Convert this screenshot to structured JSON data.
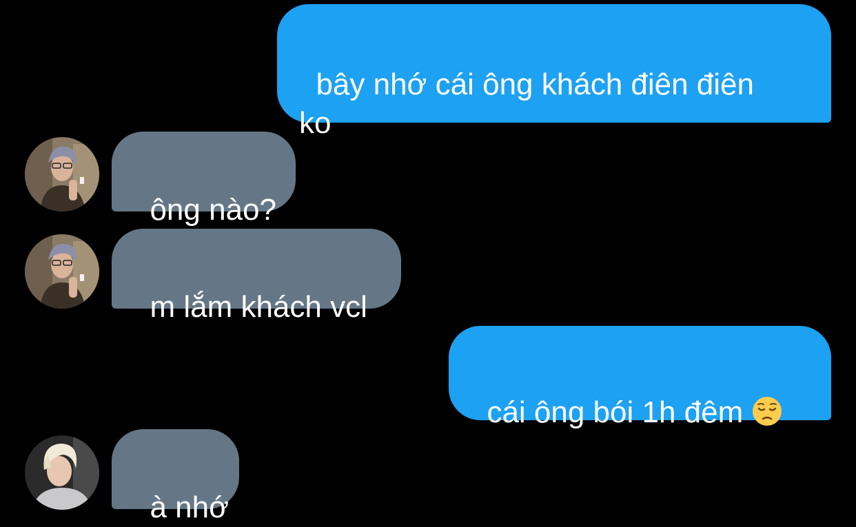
{
  "conversation": {
    "messages": [
      {
        "sender": "me",
        "text": "bây nhớ cái ông khách điên điên\nko"
      },
      {
        "sender": "them",
        "avatar": "avatar-gray-hair",
        "text": "ông nào?"
      },
      {
        "sender": "them",
        "avatar": "avatar-gray-hair",
        "text": "m lắm khách vcl"
      },
      {
        "sender": "me",
        "text": "cái ông bói 1h đêm ",
        "emoji": "pensive-face-emoji"
      },
      {
        "sender": "them",
        "avatar": "avatar-blond-hair",
        "text": "à nhớ"
      }
    ]
  },
  "colors": {
    "background": "#000000",
    "outgoing_bubble": "#1da1f2",
    "incoming_bubble": "#657786",
    "text": "#ffffff"
  }
}
